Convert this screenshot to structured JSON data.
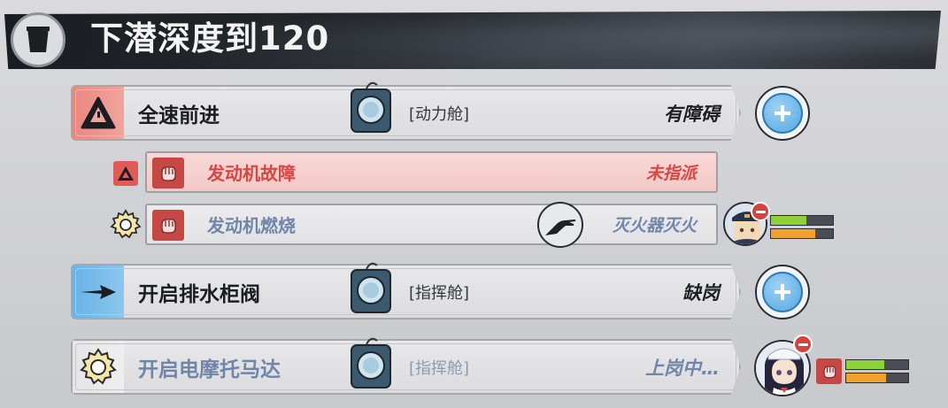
{
  "header": {
    "title": "下潜深度到120",
    "icon": "cup-icon"
  },
  "tasks": [
    {
      "label": "全速前进",
      "room": "[动力舱]",
      "status": "有障碍",
      "strip_color": "#e9877f",
      "icon": "warning-icon"
    },
    {
      "label": "开启排水柜阀",
      "room": "[指挥舱]",
      "status": "缺岗",
      "strip_color": "#69b2e6",
      "icon": "arrow-icon"
    },
    {
      "label": "开启电摩托马达",
      "room": "[指挥舱]",
      "status": "上岗中…",
      "icon": "gear-icon"
    }
  ],
  "subtasks": [
    {
      "label": "发动机故障",
      "status": "未指派",
      "icon": "fist-icon",
      "side_icon": "warning-icon"
    },
    {
      "label": "发动机燃烧",
      "status": "灭火器灭火",
      "icon": "fist-icon",
      "side_icon": "gear-icon",
      "action_icon": "hand-icon"
    }
  ],
  "crew": [
    {
      "avatar": "officer-avatar",
      "health": 0.57,
      "stamina": 0.71
    },
    {
      "avatar": "sailor-girl-avatar",
      "health": 0.61,
      "stamina": 0.64
    }
  ],
  "colors": {
    "alert_red": "#d84643",
    "muted_blue": "#6f86a8",
    "plus_blue": "#52a7e2",
    "health_green": "#8bd339",
    "stamina_orange": "#f2a12e"
  }
}
